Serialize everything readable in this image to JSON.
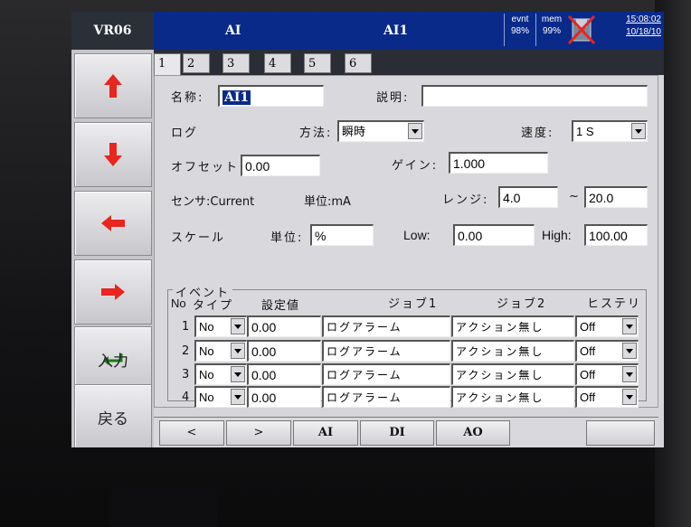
{
  "topbar": {
    "device": "VR06",
    "left_title": "AI",
    "center_title": "AI1",
    "evnt_label": "evnt",
    "evnt_value": "98%",
    "mem_label": "mem",
    "mem_value": "99%",
    "time": "15:08:02",
    "date": "10/18/10"
  },
  "sidebar": {
    "enter_label": "入力",
    "back_label": "戻る"
  },
  "tabs": [
    "1",
    "2",
    "3",
    "4",
    "5",
    "6"
  ],
  "form": {
    "name_label": "名称:",
    "name_value": "AI1",
    "desc_label": "説明:",
    "desc_value": "",
    "log_label": "ログ",
    "method_label": "方法:",
    "method_value": "瞬時",
    "speed_label": "速度:",
    "speed_value": "1 S",
    "offset_label": "オフセット",
    "offset_value": "0.00",
    "gain_label": "ゲイン:",
    "gain_value": "1.000",
    "sensor_label": "センサ:Current",
    "unit_label": "単位:mA",
    "range_label": "レンジ:",
    "range_low": "4.0",
    "range_sep": "~",
    "range_high": "20.0",
    "scale_label": "スケール",
    "scale_unit_label": "単位:",
    "scale_unit_value": "%",
    "low_label": "Low:",
    "low_value": "0.00",
    "high_label": "High:",
    "high_value": "100.00"
  },
  "events": {
    "title": "イベント",
    "headers": {
      "no": "No",
      "type": "タイプ",
      "setpoint": "設定値",
      "job1": "ジョブ1",
      "job2": "ジョブ2",
      "hysteresis": "ヒステリ"
    },
    "rows": [
      {
        "no": "1",
        "type": "No",
        "setpoint": "0.00",
        "job1": "ログアラーム",
        "job2": "アクション無し",
        "hys": "Off"
      },
      {
        "no": "2",
        "type": "No",
        "setpoint": "0.00",
        "job1": "ログアラーム",
        "job2": "アクション無し",
        "hys": "Off"
      },
      {
        "no": "3",
        "type": "No",
        "setpoint": "0.00",
        "job1": "ログアラーム",
        "job2": "アクション無し",
        "hys": "Off"
      },
      {
        "no": "4",
        "type": "No",
        "setpoint": "0.00",
        "job1": "ログアラーム",
        "job2": "アクション無し",
        "hys": "Off"
      }
    ]
  },
  "bottom": {
    "prev": "<",
    "next": ">",
    "ai": "AI",
    "di": "DI",
    "ao": "AO",
    "blank": ""
  },
  "colors": {
    "titlebar": "#0a2a8a",
    "arrow_red": "#e8251f",
    "arrow_green": "#1a7a1a"
  }
}
